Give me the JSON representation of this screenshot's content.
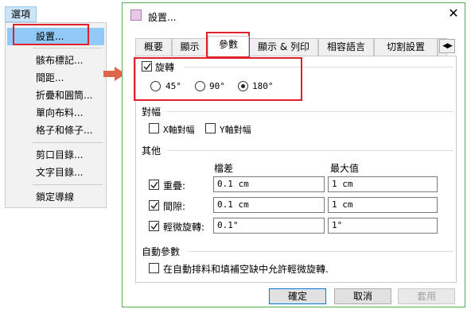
{
  "menu": {
    "title": "選項",
    "items": [
      {
        "label": "設置..."
      },
      {
        "label": "骸布標記..."
      },
      {
        "label": "間距..."
      },
      {
        "label": "折疊和圓筒..."
      },
      {
        "label": "單向布料..."
      },
      {
        "label": "格子和條子..."
      },
      {
        "label": "剪口目錄..."
      },
      {
        "label": "文字目錄..."
      },
      {
        "label": "鎖定導線"
      }
    ]
  },
  "dialog": {
    "title": "設置...",
    "tabs": [
      "概要",
      "顯示",
      "參數",
      "顯示 & 列印",
      "相容語言",
      "切割設置"
    ],
    "active_tab": "參數",
    "rotation": {
      "label": "旋轉",
      "checked": true,
      "options": [
        "45°",
        "90°",
        "180°"
      ],
      "selected": "180°"
    },
    "alignment": {
      "group_label": "對幅",
      "x_label": "X軸對幅",
      "y_label": "Y軸對幅"
    },
    "other": {
      "group_label": "其他",
      "col_tolerance": "檔差",
      "col_max": "最大值",
      "rows": [
        {
          "label": "重疊:",
          "tolerance": "0.1 cm",
          "max": "1 cm"
        },
        {
          "label": "間隙:",
          "tolerance": "0.1 cm",
          "max": "1 cm"
        },
        {
          "label": "輕微旋轉:",
          "tolerance": "0.1°",
          "max": "1°"
        }
      ]
    },
    "auto": {
      "group_label": "自動參數",
      "option_label": "在自動排料和填補空缺中允許輕微旋轉."
    },
    "buttons": {
      "ok": "確定",
      "cancel": "取消",
      "apply": "套用"
    }
  },
  "colors": {
    "highlight_red": "#e0202a",
    "menu_highlight": "#91c9f7",
    "dialog_border": "#5aa85a"
  }
}
